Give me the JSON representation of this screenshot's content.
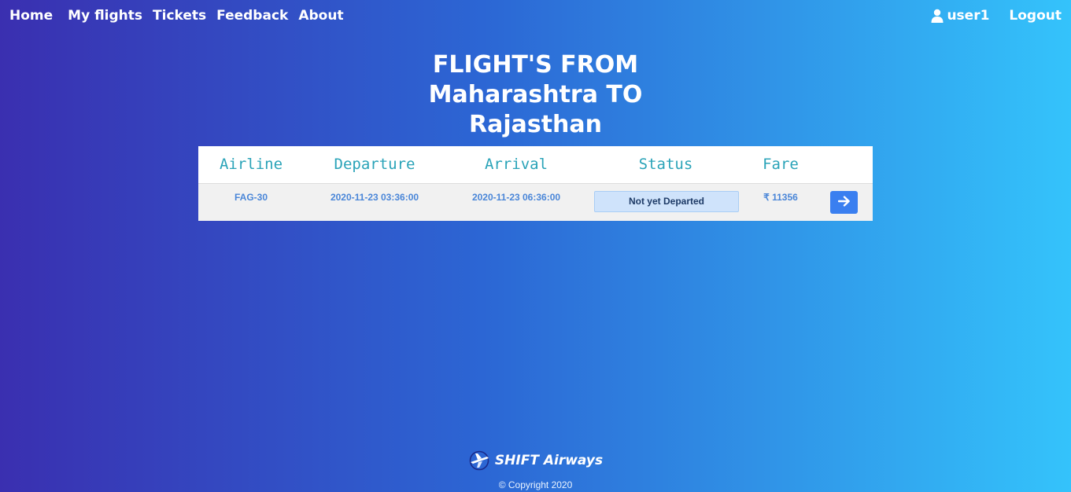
{
  "nav": {
    "links": [
      "Home",
      "My flights",
      "Tickets",
      "Feedback",
      "About"
    ],
    "user_label": "user1",
    "logout_label": "Logout"
  },
  "page": {
    "title_lines": [
      "FLIGHT'S FROM",
      "Maharashtra TO",
      "Rajasthan"
    ]
  },
  "table": {
    "headers": [
      "Airline",
      "Departure",
      "Arrival",
      "Status",
      "Fare"
    ],
    "rows": [
      {
        "airline": "FAG-30",
        "departure": "2020-11-23 03:36:00",
        "arrival": "2020-11-23 06:36:00",
        "status": "Not yet Departed",
        "fare": "₹ 11356"
      }
    ]
  },
  "footer": {
    "brand": "SHIFT Airways",
    "copyright": "© Copyright 2020"
  },
  "colors": {
    "gradient_start": "#3a2fb0",
    "gradient_end": "#34c3fb",
    "header_text": "#2aa3b8",
    "cell_text": "#4a86d8",
    "status_bg": "#cfe3fb",
    "button_bg": "#3a7ff0"
  },
  "icons": {
    "user": "user-icon",
    "go": "arrow-right-icon",
    "brand": "plane-logo-icon"
  }
}
